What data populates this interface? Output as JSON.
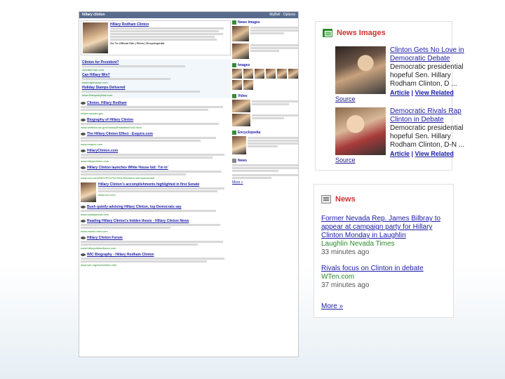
{
  "search_screenshot": {
    "query": "hillary clinton",
    "topbar_right": "MyBell · Options",
    "featured": {
      "title": "Hillary Rodham Clinton",
      "links": "Go To Official Site | Films | Encyclopedia"
    },
    "sponsored": [
      {
        "title": "Clinton for President?",
        "url": "JohnMcCain.com"
      },
      {
        "title": "Can Hillary Win?",
        "url": "www.rightcause.com"
      },
      {
        "title": "Holiday Stamps Delivered",
        "url": "www.StampsbyMail.com"
      }
    ],
    "results": [
      {
        "title": "Clinton, Hillary Rodham",
        "url": "clinton.senate.gov"
      },
      {
        "title": "Biography of Hillary Clinton",
        "url": "www.whitehouse.gov/history/firstladies/hc42.html"
      },
      {
        "title": "The Hillary Clinton Effect - Esquire.com",
        "url": "www.esquire.com"
      },
      {
        "title": "HillaryClinton.com",
        "url": "www.hillaryclinton.com"
      },
      {
        "title": "Hillary Clinton launches White House bid: 'I'm in'",
        "url": "www.cnn.com/2007/POLITICS/01/20/clinton.announcement"
      },
      {
        "title": "Hillary Clinton's accomplishments highlighted in first Senate",
        "url": "www.cnn.com"
      },
      {
        "title": "Bush quietly advising Hillary Clinton, top Democrats say",
        "url": "www.nydailynews.com"
      },
      {
        "title": "Reading Hillary Clinton's hidden thesis - Hillary Clinton News",
        "url": "www.msnbc.msn.com"
      },
      {
        "title": "Hillary Clinton Forum",
        "url": "www.hillaryclintonforum.com"
      },
      {
        "title": "WIC Biography - Hillary Rodham Clinton",
        "url": "www.wic.org/bio/hclinton.htm"
      }
    ],
    "side": {
      "news_images": "News Images",
      "images": "Images",
      "video": "Video",
      "encyclopedia": "Encyclopedia",
      "news": "News",
      "more": "More »"
    }
  },
  "news_images_panel": {
    "title": "News Images",
    "items": [
      {
        "link": "Clinton Gets No Love in Democratic Debate",
        "desc": "Democratic presidential hopeful Sen. Hillary Rodham Clinton, D ...",
        "source": "Source",
        "article": "Article",
        "view_related": "View Related"
      },
      {
        "link": "Democratic Rivals Rap Clinton in Debate",
        "desc": "Democratic presidential hopeful Sen. Hillary Rodham Clinton, D-N ...",
        "source": "Source",
        "article": "Article",
        "view_related": "View Related"
      }
    ]
  },
  "news_panel": {
    "title": "News",
    "items": [
      {
        "link": "Former Nevada Rep. James Bilbray to appear at campaign party for Hillary Clinton Monday in Laughlin",
        "source": "Laughlin Nevada Times",
        "time": "33 minutes ago"
      },
      {
        "link": "Rivals focus on Clinton in debate",
        "source": "WTen.com",
        "time": "37 minutes ago"
      }
    ],
    "more": "More »"
  }
}
